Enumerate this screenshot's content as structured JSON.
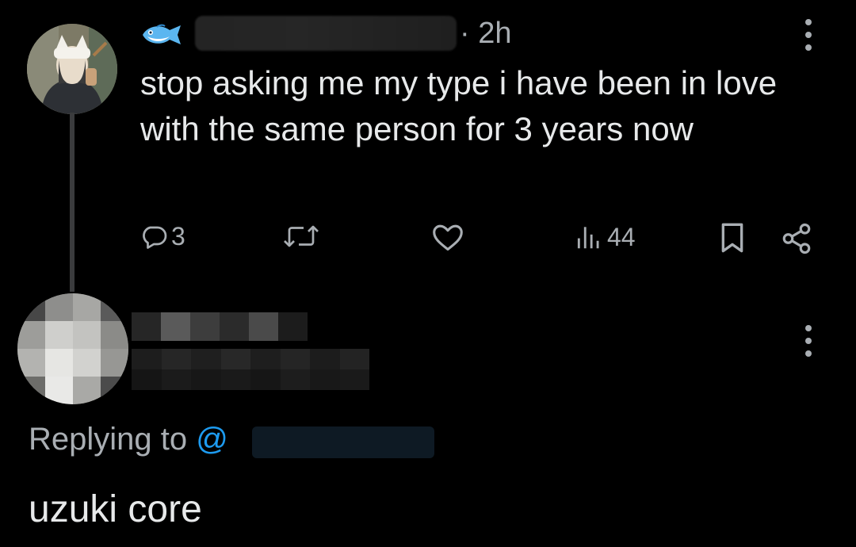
{
  "tweet": {
    "emoji_name": "fish-emoji",
    "time": "· 2h",
    "text": "stop asking me my type i have been in love with the same person for 3 years now",
    "actions": {
      "reply_count": "3",
      "retweet_count": "",
      "like_count": "",
      "views_count": "44"
    }
  },
  "reply": {
    "replying_label": "Replying to ",
    "mention_at": "@",
    "text": "uzuki core"
  },
  "colors": {
    "background": "#000000",
    "text_primary": "#e7e9ea",
    "text_secondary": "#a9aeb3",
    "accent": "#1d9bf0"
  }
}
